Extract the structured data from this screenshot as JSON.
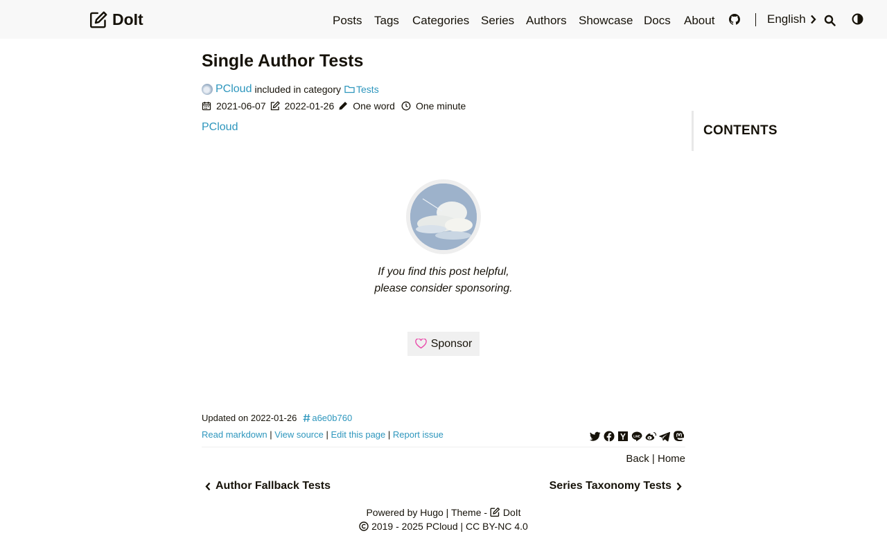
{
  "header": {
    "logo_text": "DoIt",
    "nav": [
      "Posts",
      "Tags",
      "Categories",
      "Series",
      "Authors",
      "Showcase",
      "Docs",
      "About"
    ],
    "language": "English"
  },
  "article": {
    "title": "Single Author Tests",
    "author": "PCloud",
    "category_prefix": "included in category",
    "category": "Tests",
    "published": "2021-06-07",
    "modified": "2022-01-26",
    "word_count": "One word",
    "reading_time": "One minute",
    "body_author_link": "PCloud"
  },
  "toc": {
    "title": "CONTENTS"
  },
  "sponsor": {
    "text": "If you find this post helpful, please consider sponsoring.",
    "button_label": "Sponsor"
  },
  "post_footer": {
    "updated_label": "Updated on 2022-01-26",
    "commit_hash": "a6e0b760",
    "links": [
      "Read markdown",
      "View source",
      "Edit this page",
      "Report issue"
    ],
    "back": "Back",
    "home": "Home",
    "prev_post": "Author Fallback Tests",
    "next_post": "Series Taxonomy Tests",
    "share_icons": [
      "twitter-icon",
      "facebook-icon",
      "hackernews-icon",
      "line-icon",
      "weibo-icon",
      "telegram-icon",
      "mastodon-icon"
    ]
  },
  "site_footer": {
    "powered_prefix": "Powered by",
    "hugo": "Hugo",
    "theme_prefix": "Theme -",
    "theme": "DoIt",
    "copyright_years": "2019 - 2025",
    "copyright_owner": "PCloud",
    "license": "CC BY-NC 4.0"
  },
  "colors": {
    "link": "#2d96bd",
    "header_bg": "#f8f8f8",
    "text": "#161209",
    "heart": "#ea4aaa"
  }
}
